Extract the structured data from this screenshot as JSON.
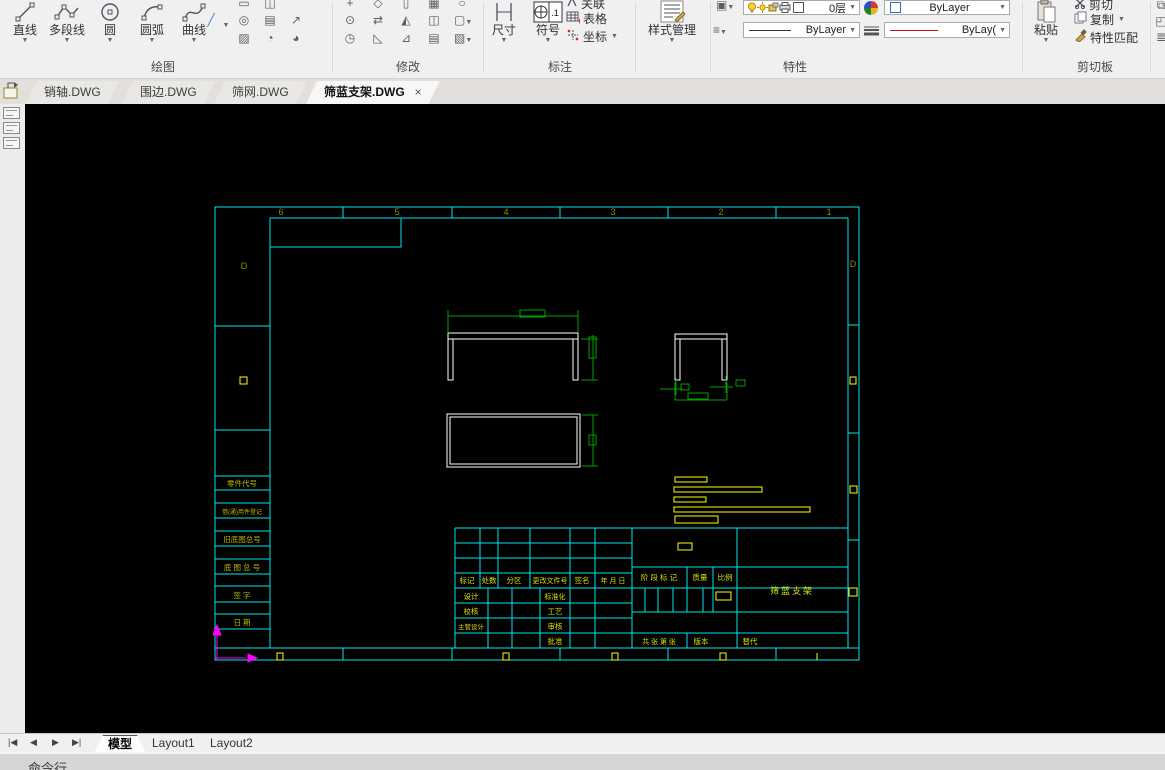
{
  "ribbon": {
    "groups": {
      "draw": {
        "label": "绘图",
        "big": [
          {
            "label": "直线"
          },
          {
            "label": "多段线"
          },
          {
            "label": "圆"
          },
          {
            "label": "圆弧"
          },
          {
            "label": "曲线"
          }
        ]
      },
      "modify": {
        "label": "修改"
      },
      "annotate": {
        "label": "标注",
        "dim_label": "尺寸",
        "symbol_label": "符号",
        "assoc_label": "关联",
        "table_label": "表格",
        "coord_label": "坐标",
        "symbol_icon_text": ".1"
      },
      "style": {
        "label": "样式管理"
      },
      "properties": {
        "label": "特性",
        "layer_value": "0层",
        "color_value": "ByLayer",
        "linetype_value": "ByLayer",
        "linetype2_value": "ByLay("
      },
      "clipboard": {
        "label": "剪切板",
        "paste_label": "粘贴",
        "cut_label": "剪切",
        "copy_label": "复制",
        "match_label": "特性匹配"
      }
    }
  },
  "file_tabs": {
    "tab0": "销轴.DWG",
    "tab1": "围边.DWG",
    "tab2": "筛网.DWG",
    "tab3": "筛蓝支架.DWG",
    "close_glyph": "×"
  },
  "drawing": {
    "zones": [
      "6",
      "5",
      "4",
      "3",
      "2",
      "1"
    ],
    "zone_letter": "D",
    "left_labels": [
      "零件代号",
      "借(通)用件登记",
      "旧底图总号",
      "底 图 总 号",
      "签    字",
      "日    期"
    ],
    "tb": {
      "h0": "标记",
      "h1": "处数",
      "h2": "分区",
      "h3": "更改文件号",
      "h4": "签名",
      "h5": "年 月 日",
      "r0": "设计",
      "r1": "校核",
      "r2": "主管设计",
      "c0": "标准化",
      "c1": "工艺",
      "c2": "审核",
      "c3": "批准",
      "stage": "阶 段 标 记",
      "mass": "质量",
      "scale": "比例",
      "name": "筛蓝支架",
      "sheets": "共  张 第  张",
      "version": "版本",
      "replace": "替代"
    }
  },
  "layout_tabs": {
    "model": "模型",
    "l1": "Layout1",
    "l2": "Layout2"
  },
  "command_line": "命令行"
}
